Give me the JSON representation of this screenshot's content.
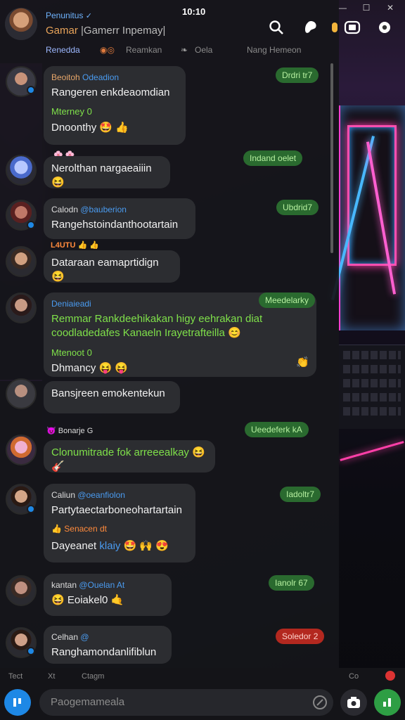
{
  "window": {
    "controls": [
      "—",
      "☐",
      "✕"
    ],
    "clock": "10:10"
  },
  "header": {
    "contact_name": "Penunitus",
    "verified_mark": "✓",
    "status_highlight": "Gamar",
    "status_muted": "|Gamerr Inpemay|",
    "icons": [
      "search-icon",
      "paint-icon",
      "camera-icon",
      "video-icon",
      "settings-icon"
    ]
  },
  "tabs": [
    {
      "label": "Renedda",
      "active": true
    },
    {
      "label": "Reamkan",
      "active": false
    },
    {
      "label": "Oela",
      "active": false
    },
    {
      "label": "Nang Hemeon",
      "active": false
    }
  ],
  "messages": [
    {
      "sender": "Beoitoh",
      "tag": "Odeadion",
      "text": "Rangeren enkdeaomdian",
      "green_line": "Mterney 0",
      "sub": "Dnoonthy 🤩 👍",
      "time": "Drdri tr7",
      "time_style": "green"
    },
    {
      "label": "🌸 🌸",
      "text": "Nerolthan nargaeaiiin 😆",
      "time": "Indand oelet",
      "time_style": "green"
    },
    {
      "sender": "Calodn",
      "tag": "@bauberion",
      "text": "Rangehstoindanthootartain",
      "time": "Ubdrid7",
      "time_style": "green"
    },
    {
      "label": "L4UTU 👍 👍",
      "text": "Dataraan eamaprtidign 😆",
      "time": "",
      "time_style": "green"
    },
    {
      "sender": "Deniaieadi",
      "green_text": "Remmar Rankdeehikakan higy eehrakan diat coodladedafes Kanaeln Irayetrafteilla 😊",
      "green_line": "Mtenoot 0",
      "sub": "Dhmancy 😝 😝",
      "trailing": "👏",
      "time": "Meedelarky",
      "time_style": "green"
    },
    {
      "text": "Bansjreen emokentekun",
      "time": "",
      "time_style": "green"
    },
    {
      "label": "😈 Bonarje G",
      "green_text": "Clonumitrade fok arreeealkay 😆 🎸",
      "time": "Ueedeferk kA",
      "time_style": "green"
    },
    {
      "sender": "Caliun",
      "tag": "@oeanfiolon",
      "text": "Partytaectarboneohartartain",
      "label_inner": "👍 Senacen dt",
      "sub_parts": [
        "Dayeanet",
        "klaiy",
        "🤩 🙌 😍"
      ],
      "time": "Iadoltr7",
      "time_style": "green"
    },
    {
      "sender": "kantan",
      "tag": "@Ouelan At",
      "text": "😆 Eoiakel0 🤙",
      "time": "Ianolr 67",
      "time_style": "green"
    },
    {
      "sender": "Celhan",
      "tag": "@",
      "text": "Ranghamondanlifiblun",
      "time": "Soledor 2",
      "time_style": "red"
    }
  ],
  "bottom_hints": [
    "Tect",
    "Xt",
    "Ctagm",
    "Co"
  ],
  "composer": {
    "placeholder": "Paogemameala"
  },
  "colors": {
    "accent_blue": "#1e88e5",
    "time_green": "#2a6a2f",
    "time_red": "#b3281f",
    "send_green": "#2e9e44"
  }
}
